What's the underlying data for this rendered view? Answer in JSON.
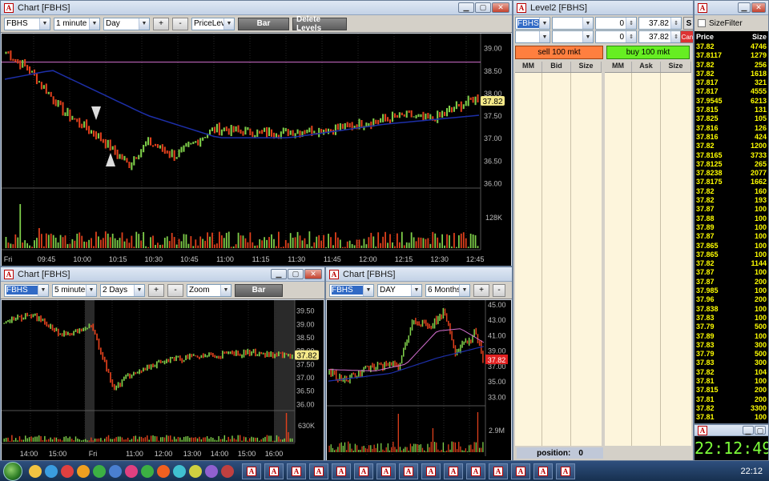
{
  "chart1": {
    "title": "Chart [FBHS]",
    "symbol": "FBHS",
    "interval": "1 minute",
    "range": "Day",
    "tool": "PriceLeve",
    "plus": "+",
    "minus": "-",
    "style_btn": "Bar",
    "delete_btn": "Delete Levels",
    "price_ticks": [
      "39.00",
      "38.50",
      "38.00",
      "37.50",
      "37.00",
      "36.50",
      "36.00"
    ],
    "last_price": "37.82",
    "volume_label": "128K",
    "time_ticks": [
      "Fri",
      "09:45",
      "10:00",
      "10:15",
      "10:30",
      "10:45",
      "11:00",
      "11:15",
      "11:30",
      "11:45",
      "12:00",
      "12:15",
      "12:30",
      "12:45"
    ]
  },
  "chart2": {
    "title": "Chart [FBHS]",
    "symbol": "FBHS",
    "interval": "5 minutes",
    "range": "2 Days",
    "tool": "Zoom",
    "plus": "+",
    "minus": "-",
    "style_btn": "Bar",
    "price_ticks": [
      "39.50",
      "39.00",
      "38.50",
      "38.00",
      "37.50",
      "37.00",
      "36.50",
      "36.00"
    ],
    "last_price": "37.82",
    "volume_label": "630K",
    "time_ticks": [
      "14:00",
      "15:00",
      "Fri",
      "11:00",
      "12:00",
      "13:00",
      "14:00",
      "15:00",
      "16:00"
    ]
  },
  "chart3": {
    "title": "Chart [FBHS]",
    "symbol": "FBHS",
    "interval": "DAY",
    "range": "6 Months",
    "plus": "+",
    "minus": "-",
    "price_ticks": [
      "45.00",
      "43.00",
      "41.00",
      "39.00",
      "37.00",
      "35.00",
      "33.00"
    ],
    "last_price": "37.82",
    "volume_label": "2.9M"
  },
  "level2": {
    "title": "Level2 [FBHS]",
    "symbol": "FBHS",
    "qty1": "0",
    "price1": "37.82",
    "qty2": "0",
    "price2": "37.82",
    "s_btn": "S",
    "can_btn": "Can",
    "sell_btn": "sell 100 mkt",
    "buy_btn": "buy 100 mkt",
    "bid_headers": [
      "MM",
      "Bid",
      "Size"
    ],
    "ask_headers": [
      "MM",
      "Ask",
      "Size"
    ],
    "position_label": "position:",
    "position_value": "0"
  },
  "timesales": {
    "filter_label": "SizeFilter",
    "headers": [
      "Price",
      "Size"
    ],
    "rows": [
      [
        "37.82",
        "4746"
      ],
      [
        "37.8117",
        "1279"
      ],
      [
        "37.82",
        "256"
      ],
      [
        "37.82",
        "1618"
      ],
      [
        "37.817",
        "321"
      ],
      [
        "37.817",
        "4555"
      ],
      [
        "37.9545",
        "6213"
      ],
      [
        "37.815",
        "131"
      ],
      [
        "37.825",
        "105"
      ],
      [
        "37.816",
        "126"
      ],
      [
        "37.816",
        "424"
      ],
      [
        "37.82",
        "1200"
      ],
      [
        "37.8165",
        "3733"
      ],
      [
        "37.8125",
        "265"
      ],
      [
        "37.8238",
        "2077"
      ],
      [
        "37.8175",
        "1662"
      ],
      [
        "37.82",
        "160"
      ],
      [
        "37.82",
        "193"
      ],
      [
        "37.87",
        "100"
      ],
      [
        "37.88",
        "100"
      ],
      [
        "37.89",
        "100"
      ],
      [
        "37.87",
        "100"
      ],
      [
        "37.865",
        "100"
      ],
      [
        "37.865",
        "100"
      ],
      [
        "37.82",
        "1144"
      ],
      [
        "37.87",
        "100"
      ],
      [
        "37.87",
        "200"
      ],
      [
        "37.985",
        "100"
      ],
      [
        "37.96",
        "200"
      ],
      [
        "37.838",
        "100"
      ],
      [
        "37.83",
        "100"
      ],
      [
        "37.79",
        "500"
      ],
      [
        "37.89",
        "100"
      ],
      [
        "37.83",
        "300"
      ],
      [
        "37.79",
        "500"
      ],
      [
        "37.83",
        "300"
      ],
      [
        "37.82",
        "104"
      ],
      [
        "37.81",
        "100"
      ],
      [
        "37.815",
        "200"
      ],
      [
        "37.81",
        "200"
      ],
      [
        "37.82",
        "3300"
      ],
      [
        "37.81",
        "100"
      ]
    ]
  },
  "clock": {
    "time": "22:12:49"
  },
  "taskbar": {
    "clock": "22:12"
  },
  "colors": {
    "up_bar": "#7fd04a",
    "down_bar": "#e0401c",
    "ma_line": "#1d2fa8",
    "level_line": "#d46fd0",
    "price_tag": "#f5e98a",
    "sell_btn": "#ff7f3f",
    "buy_btn": "#66ee22"
  }
}
